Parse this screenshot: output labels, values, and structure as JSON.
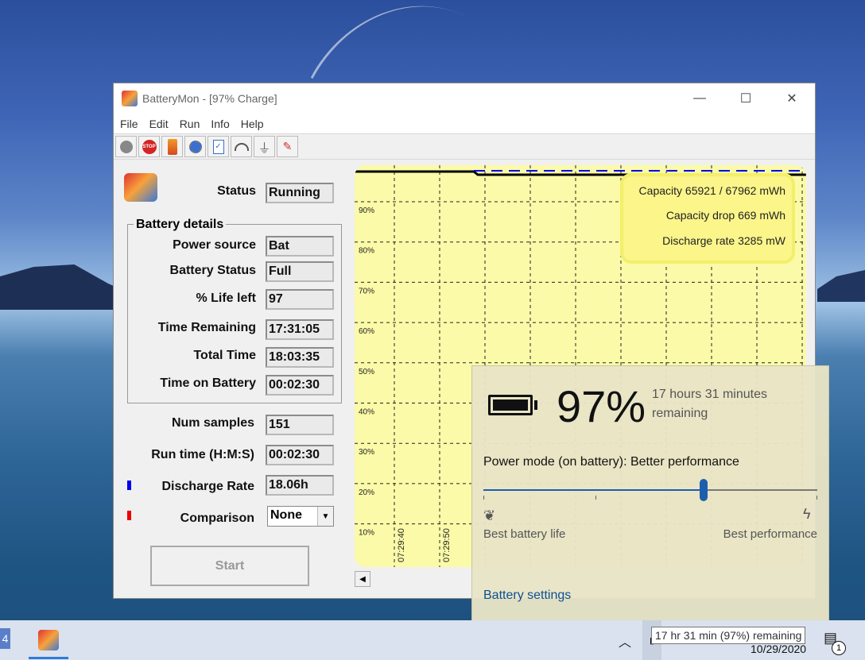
{
  "window": {
    "title": "BatteryMon - [97% Charge]",
    "controls": {
      "minimize": "—",
      "maximize": "☐",
      "close": "✕"
    }
  },
  "menu": [
    "File",
    "Edit",
    "Run",
    "Info",
    "Help"
  ],
  "toolbar_icons": [
    "record-icon",
    "stop-icon",
    "battery-icon",
    "settings-icon",
    "checklist-icon",
    "gauge-icon",
    "plug-icon",
    "tools-icon"
  ],
  "status": {
    "label": "Status",
    "value": "Running"
  },
  "battery_details": {
    "title": "Battery details",
    "rows": [
      {
        "label": "Power source",
        "value": "Bat"
      },
      {
        "label": "Battery Status",
        "value": "Full"
      },
      {
        "label": "% Life left",
        "value": "97"
      },
      {
        "label": "Time Remaining",
        "value": "17:31:05"
      },
      {
        "label": "Total Time",
        "value": "18:03:35"
      },
      {
        "label": "Time on Battery",
        "value": "00:02:30"
      }
    ]
  },
  "stats": [
    {
      "label": "Num samples",
      "value": "151"
    },
    {
      "label": "Run time (H:M:S)",
      "value": "00:02:30"
    },
    {
      "label": "Discharge Rate",
      "value": "18.06h",
      "marker_color": "#0000ee"
    },
    {
      "label": "Comparison",
      "value": "None",
      "marker_color": "#ee0000"
    }
  ],
  "start_button": "Start",
  "graph": {
    "info_lines": [
      "Capacity 65921 / 67962 mWh",
      "Capacity drop 669 mWh",
      "Discharge rate 3285 mW"
    ],
    "y_ticks": [
      "90%",
      "80%",
      "70%",
      "60%",
      "50%",
      "40%",
      "30%",
      "20%",
      "10%"
    ],
    "x_ticks": [
      "07:29:40",
      "07:29:50"
    ],
    "background": "#fbfaa8"
  },
  "flyout": {
    "percent": "97%",
    "remaining": "17 hours 31 minutes remaining",
    "power_mode": "Power mode (on battery): Better performance",
    "slider_level": 0.66,
    "left_label": "Best battery life",
    "right_label": "Best performance",
    "settings_link": "Battery settings"
  },
  "taskbar": {
    "tooltip": "17 hr 31 min (97%) remaining",
    "date": "10/29/2020",
    "notification_count": "1",
    "start_glyph": "4"
  }
}
